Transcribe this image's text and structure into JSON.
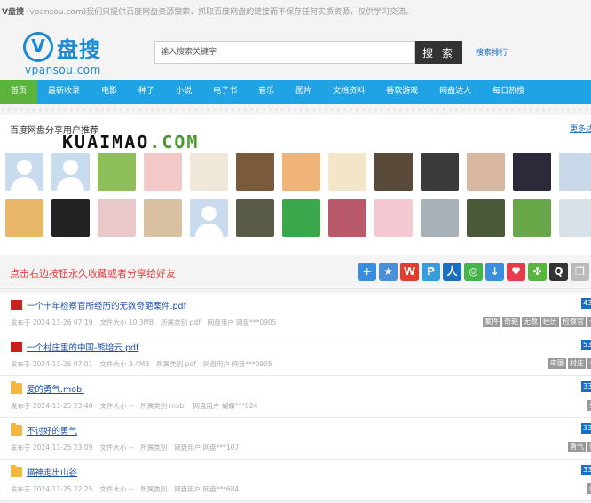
{
  "topbar": {
    "brand": "V盘搜",
    "text": " (vpansou.com)我们只提供百度网盘资源搜索，抓取百度网盘的链接而不保存任何实质资源，仅供学习交流。"
  },
  "logo": {
    "mark": "V",
    "name_cn": "盘搜",
    "name_en": "vpansou.com"
  },
  "search": {
    "placeholder": "输入搜索关键字",
    "button": "搜 索",
    "rank_link": "搜索排行"
  },
  "nav": [
    "首页",
    "最新收录",
    "电影",
    "种子",
    "小说",
    "电子书",
    "音乐",
    "图片",
    "文档资料",
    "番软游戏",
    "网盘达人",
    "每日热搜"
  ],
  "users": {
    "title": "百度网盘分享用户推荐",
    "more": "更多达",
    "watermark_a": "KUAIMAO",
    "watermark_b": ".COM",
    "row1": [
      "default",
      "default",
      "#8fbf5a",
      "#f2c8c8",
      "#efe8d8",
      "#7a5a3a",
      "#f0b478",
      "#f3e6c8",
      "#5a4a3a",
      "#3a3a3a",
      "#d8b8a0",
      "#2a2a3a",
      "#c8d8e8"
    ],
    "row2": [
      "#e8b868",
      "#222222",
      "#e8c8c8",
      "#d8c0a0",
      "default",
      "#5a5a48",
      "#3aa84a",
      "#b85a6a",
      "#f4c8d0",
      "#a8b0b8",
      "#4a5a38",
      "#68a848",
      "#d8e0e8"
    ]
  },
  "share": {
    "text": "点击右边按钮永久收藏或者分享给好友",
    "icons": [
      {
        "name": "plus-share-icon",
        "glyph": "+",
        "color": "#3a8ee0"
      },
      {
        "name": "favorite-star-icon",
        "glyph": "★",
        "color": "#4a90d9"
      },
      {
        "name": "sina-weibo-icon",
        "glyph": "W",
        "color": "#e23c2c"
      },
      {
        "name": "tencent-weibo-icon",
        "glyph": "P",
        "color": "#3a9bd9"
      },
      {
        "name": "renren-icon",
        "glyph": "人",
        "color": "#1a6fc4"
      },
      {
        "name": "wechat-icon",
        "glyph": "◎",
        "color": "#44b549"
      },
      {
        "name": "baidu-icon",
        "glyph": "↓",
        "color": "#3a8ee0"
      },
      {
        "name": "heart-icon",
        "glyph": "♥",
        "color": "#e83a4a"
      },
      {
        "name": "kaixin-icon",
        "glyph": "✤",
        "color": "#55b83a"
      },
      {
        "name": "qq-icon",
        "glyph": "Q",
        "color": "#333333"
      },
      {
        "name": "copy-icon",
        "glyph": "❐",
        "color": "#bbbbbb"
      }
    ]
  },
  "items": [
    {
      "type": "pdf",
      "title": "一个十年检察官所经历的无数奇葩案件.pdf",
      "date": "发布于  2024-11-26 07:19",
      "size": "文件大小  10.3MB",
      "category": "所属类别  pdf",
      "user": "网盘用户  网盘***0905",
      "count": "43",
      "tags": [
        "案件",
        "奇葩",
        "无数",
        "经历",
        "检察官",
        "一"
      ]
    },
    {
      "type": "pdf",
      "title": "一个村庄里的中国-熊培云.pdf",
      "date": "发布于  2024-11-26 07:01",
      "size": "文件大小  3.4MB",
      "category": "所属类别  pdf",
      "user": "网盘用户  网盘***0905",
      "count": "53",
      "tags": [
        "中国",
        "村庄",
        "一"
      ]
    },
    {
      "type": "folder",
      "title": "爱的勇气.mobi",
      "date": "发布于  2024-11-25 23:48",
      "size": "文件大小  --",
      "category": "所属类别  mobi",
      "user": "网盘用户  蝴蝶***024",
      "count": "33",
      "tags": [
        "勇"
      ]
    },
    {
      "type": "folder",
      "title": "不讨好的勇气",
      "date": "发布于  2024-11-25 23:09",
      "size": "文件大小  --",
      "category": "所属类别",
      "user": "网盘用户  网盘***107",
      "count": "33",
      "tags": [
        "勇气",
        "讨"
      ]
    },
    {
      "type": "folder",
      "title": "猫神走出山谷",
      "date": "发布于  2024-11-25 22:25",
      "size": "文件大小  --",
      "category": "所属类别",
      "user": "网盘用户  网盘***684",
      "count": "33",
      "tags": [
        "山"
      ]
    }
  ]
}
